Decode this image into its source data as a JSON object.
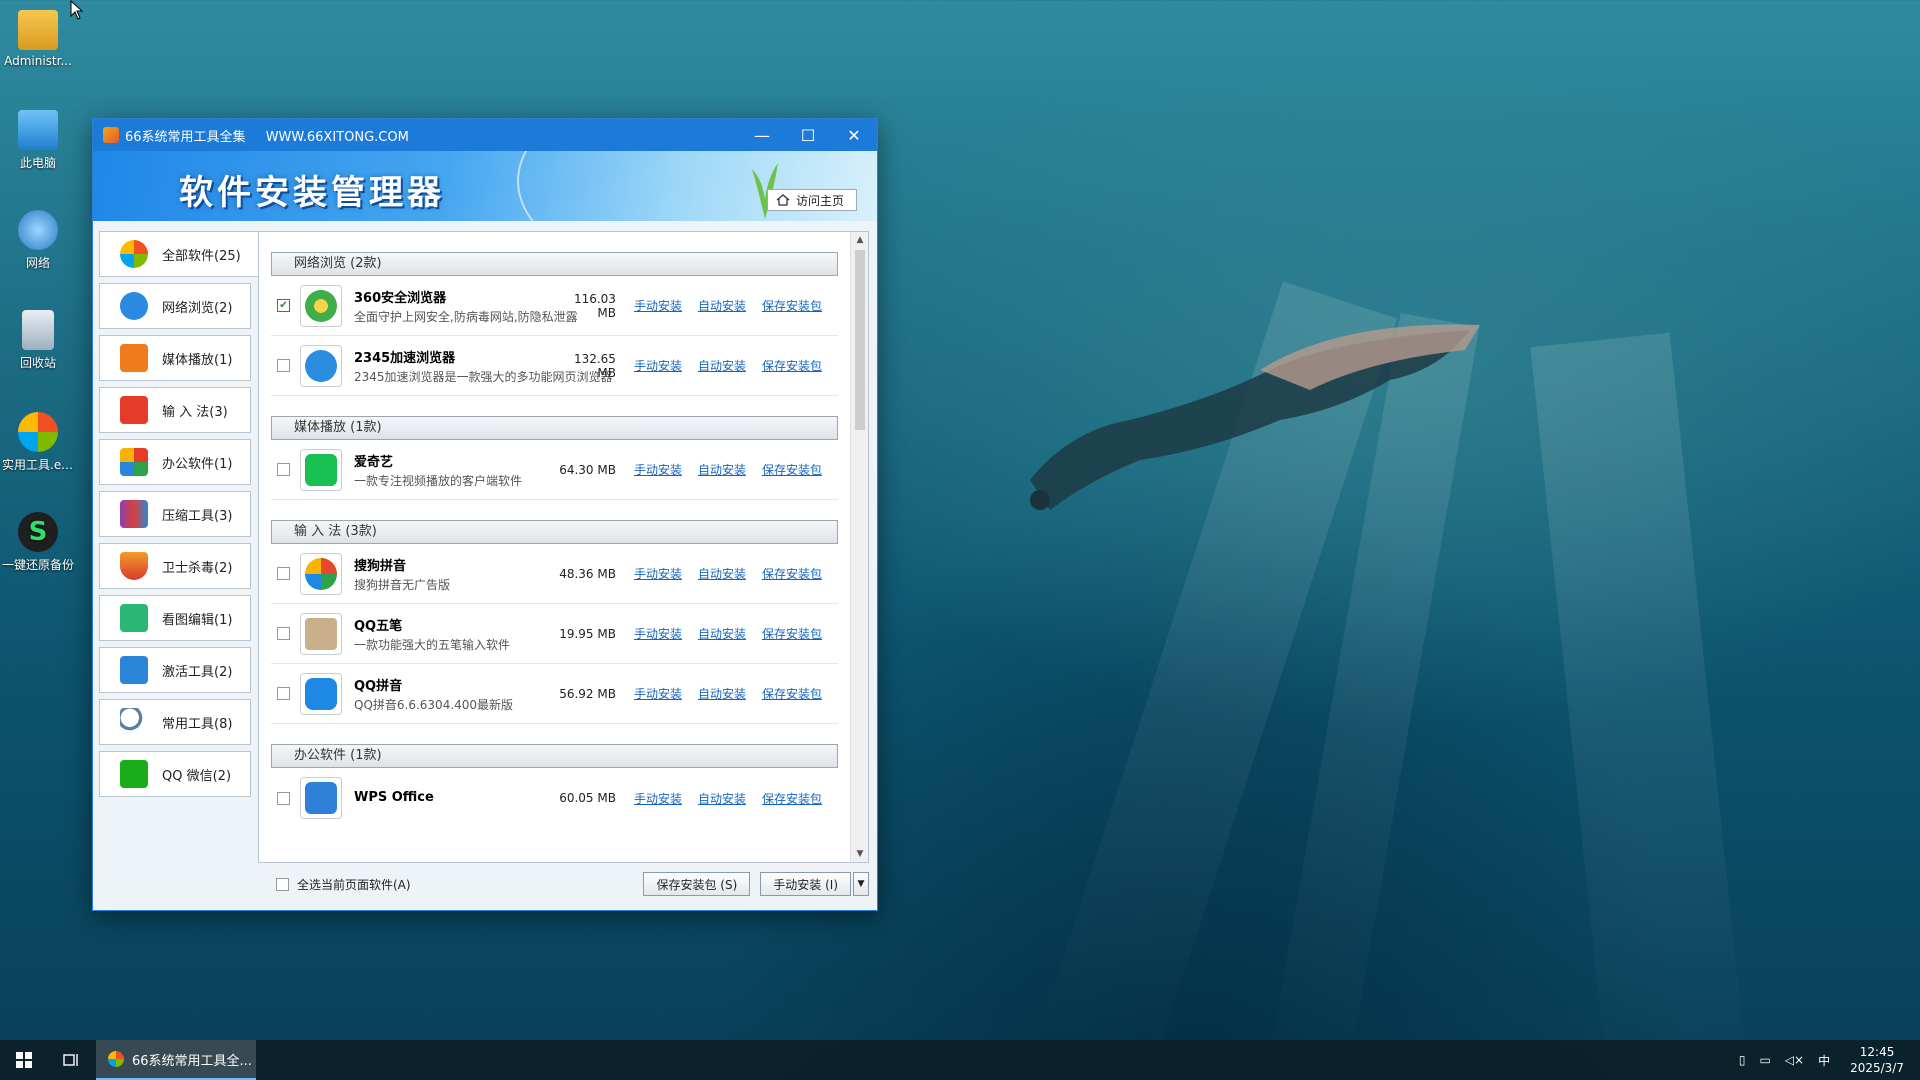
{
  "desktop": {
    "icons": [
      {
        "label": "Administr..."
      },
      {
        "label": "此电脑"
      },
      {
        "label": "网络"
      },
      {
        "label": "回收站"
      },
      {
        "label": "实用工具.exe"
      },
      {
        "label": "一键还原备份"
      }
    ]
  },
  "window": {
    "title": "66系统常用工具全集",
    "url": "WWW.66XITONG.COM",
    "minimize": "—",
    "maximize": "☐",
    "close": "✕",
    "banner_title": "软件安装管理器",
    "home_button": "访问主页"
  },
  "sidebar": {
    "items": [
      {
        "label": "全部软件(25)",
        "color": "#3b86d6"
      },
      {
        "label": "网络浏览(2)",
        "color": "#2a8ae2"
      },
      {
        "label": "媒体播放(1)",
        "color": "#f07b1c"
      },
      {
        "label": "输 入 法(3)",
        "color": "#e53c2a"
      },
      {
        "label": "办公软件(1)",
        "color": "#2da24a"
      },
      {
        "label": "压缩工具(3)",
        "color": "#8a3fb0"
      },
      {
        "label": "卫士杀毒(2)",
        "color": "#d93a2a"
      },
      {
        "label": "看图编辑(1)",
        "color": "#2bb673"
      },
      {
        "label": "激活工具(2)",
        "color": "#2a86d8"
      },
      {
        "label": "常用工具(8)",
        "color": "#5a7fa8"
      },
      {
        "label": "QQ 微信(2)",
        "color": "#1aad19"
      }
    ]
  },
  "list": {
    "link_manual": "手动安装",
    "link_auto": "自动安装",
    "link_save": "保存安装包",
    "categories": [
      {
        "title": "网络浏览 (2款)",
        "items": [
          {
            "name": "360安全浏览器",
            "desc": "全面守护上网安全,防病毒网站,防隐私泄露",
            "size": "116.03 MB",
            "checked": "✔",
            "color": "#3fae49"
          },
          {
            "name": "2345加速浏览器",
            "desc": "2345加速浏览器是一款强大的多功能网页浏览器",
            "size": "132.65 MB",
            "checked": "",
            "color": "#2b8de0"
          }
        ]
      },
      {
        "title": "媒体播放 (1款)",
        "items": [
          {
            "name": "爱奇艺",
            "desc": "一款专注视频播放的客户端软件",
            "size": "64.30 MB",
            "checked": "",
            "color": "#17c050"
          }
        ]
      },
      {
        "title": "输 入 法 (3款)",
        "items": [
          {
            "name": "搜狗拼音",
            "desc": "搜狗拼音无广告版",
            "size": "48.36 MB",
            "checked": "",
            "color": "#e8462e"
          },
          {
            "name": "QQ五笔",
            "desc": "一款功能强大的五笔输入软件",
            "size": "19.95 MB",
            "checked": "",
            "color": "#8b6a4a"
          },
          {
            "name": "QQ拼音",
            "desc": "QQ拼音6.6.6304.400最新版",
            "size": "56.92 MB",
            "checked": "",
            "color": "#1e88e5"
          }
        ]
      },
      {
        "title": "办公软件 (1款)",
        "items": [
          {
            "name": "WPS Office",
            "desc": "",
            "size": "60.05 MB",
            "checked": "",
            "color": "#2f80d8"
          }
        ]
      }
    ]
  },
  "bottom": {
    "select_all": "全选当前页面软件(A)",
    "save_button": "保存安装包 (S)",
    "install_button": "手动安装 (I)",
    "dropdown": "▼"
  },
  "taskbar": {
    "app_label": "66系统常用工具全...",
    "ime": "中",
    "time": "12:45",
    "date": "2025/3/7"
  }
}
